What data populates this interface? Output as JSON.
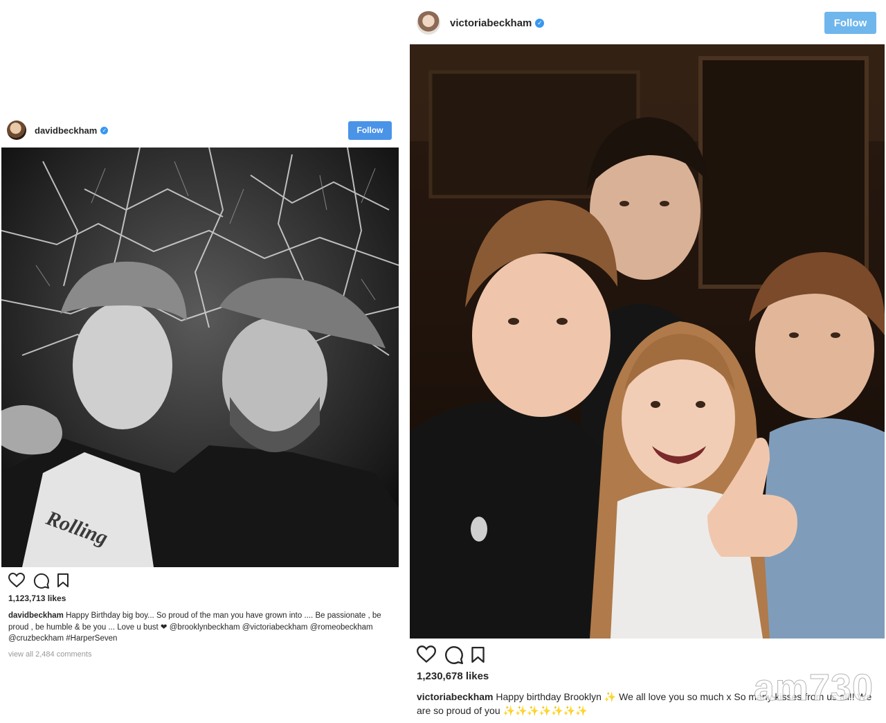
{
  "posts": {
    "david": {
      "username": "davidbeckham",
      "follow_label": "Follow",
      "likes": "1,123,713 likes",
      "caption_user": "davidbeckham",
      "caption_text": "Happy Birthday big boy... So proud of the man you have grown into .... Be passionate , be proud , be humble & be you ... Love u bust ❤ @brooklynbeckham @victoriabeckham @romeobeckham @cruzbeckham #HarperSeven",
      "view_all": "view all 2,484 comments",
      "photo_desc_icon": "black-and-white-photo"
    },
    "victoria": {
      "username": "victoriabeckham",
      "follow_label": "Follow",
      "likes": "1,230,678 likes",
      "caption_user": "victoriabeckham",
      "caption_text": "Happy birthday Brooklyn ✨ We all love you so much x So many kisses from us all!! We are so proud of you ✨✨✨✨✨✨✨",
      "photo_desc_icon": "color-photo"
    }
  },
  "watermark": "am730",
  "colors": {
    "follow_blue": "#3897f0",
    "verified_blue": "#3897f0"
  },
  "icons": [
    "heart-icon",
    "comment-icon",
    "bookmark-icon",
    "verified-badge-icon"
  ]
}
